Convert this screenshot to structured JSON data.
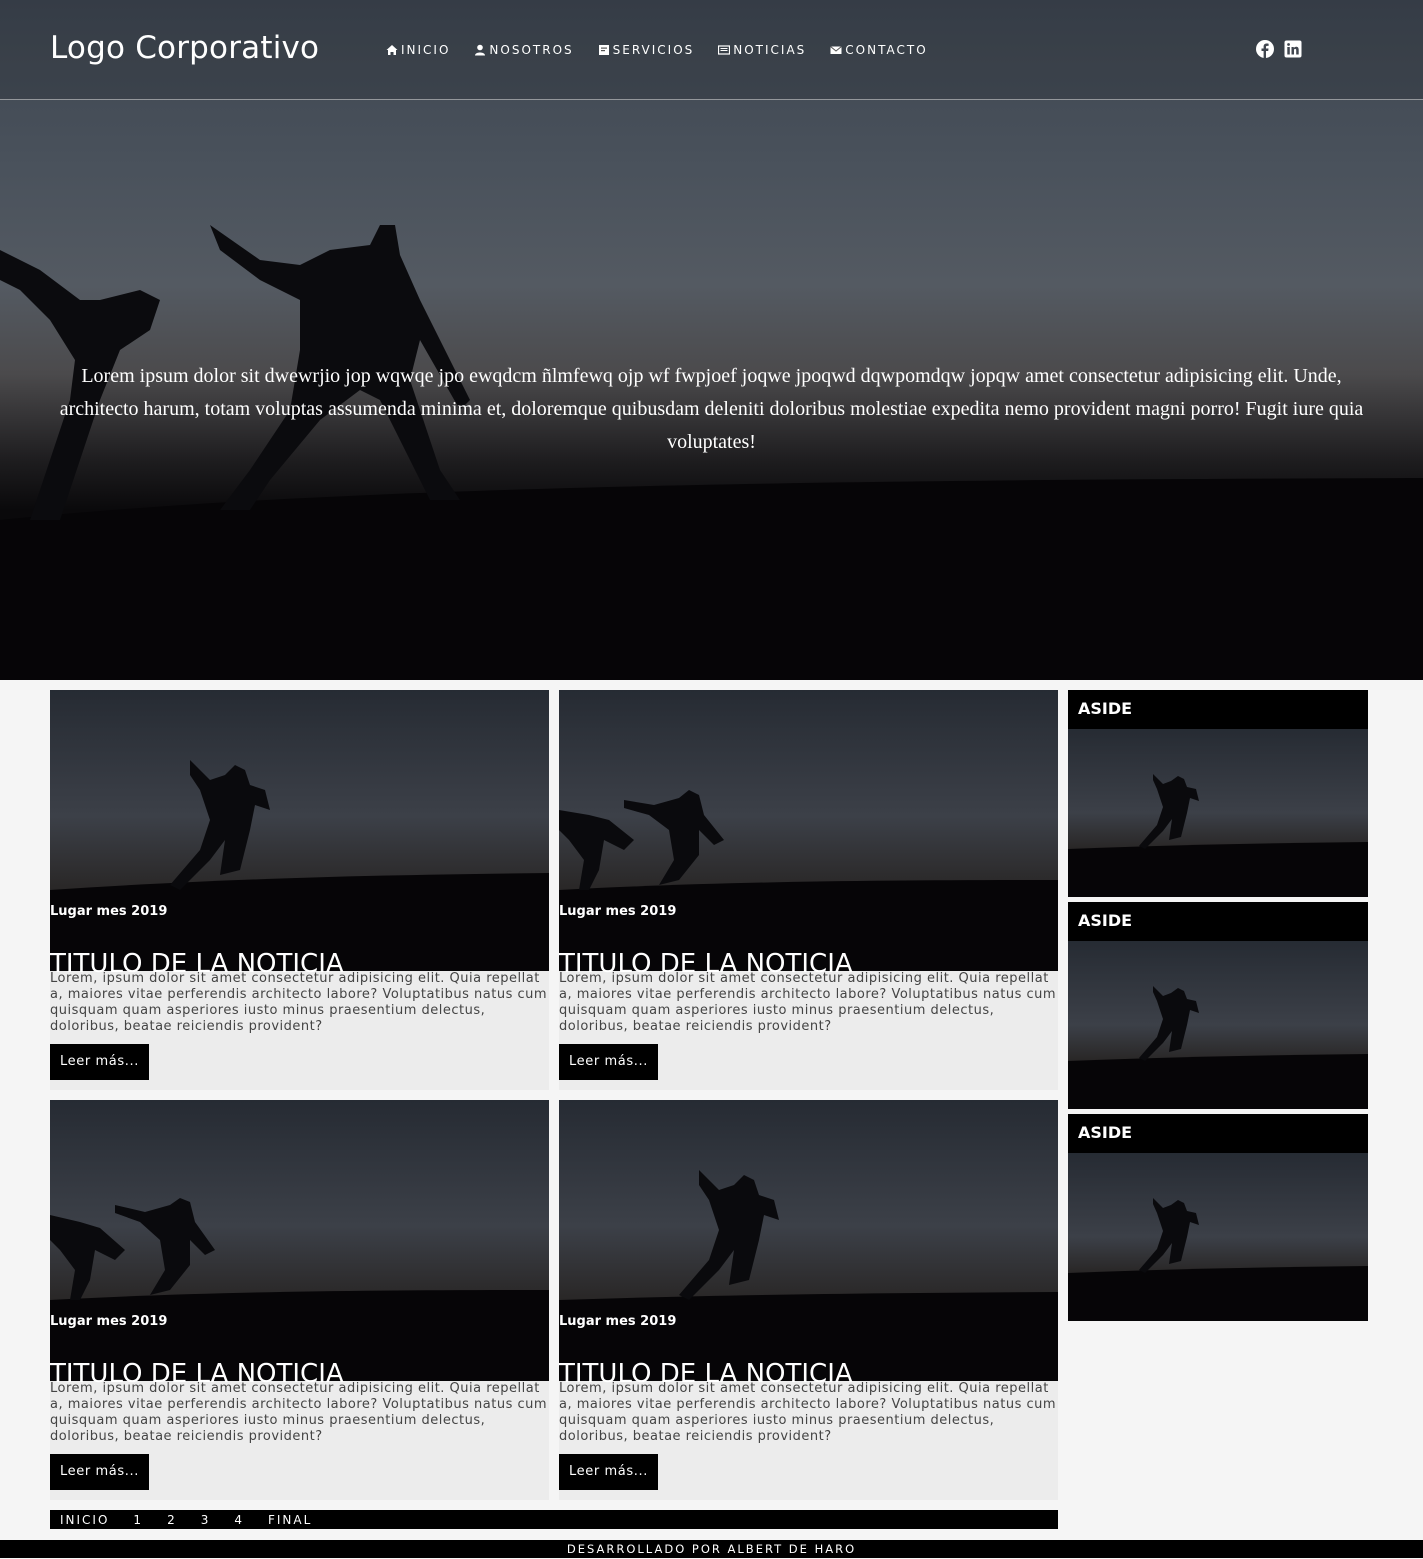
{
  "header": {
    "logo": "Logo Corporativo",
    "nav": [
      {
        "label": "INICIO",
        "icon": "home-icon"
      },
      {
        "label": "NOSOTROS",
        "icon": "user-icon"
      },
      {
        "label": "SERVICIOS",
        "icon": "services-icon"
      },
      {
        "label": "NOTICIAS",
        "icon": "newspaper-icon"
      },
      {
        "label": "CONTACTO",
        "icon": "envelope-icon"
      }
    ],
    "social": [
      "facebook-icon",
      "linkedin-icon"
    ]
  },
  "hero": {
    "text": "Lorem ipsum dolor sit dwewrjio jop wqwqe jpo ewqdcm ñlmfewq ojp wf fwpjoef joqwe jpoqwd dqwpomdqw jopqw amet consectetur adipisicing elit. Unde, architecto harum, totam voluptas assumenda minima et, doloremque quibusdam deleniti doloribus molestiae expedita nemo provident magni porro! Fugit iure quia voluptates!"
  },
  "cards": [
    {
      "meta": "Lugar mes 2019",
      "title": "TITULO DE LA NOTICIA",
      "excerpt": "Lorem, ipsum dolor sit amet consectetur adipisicing elit. Quia repellat a, maiores vitae perferendis architecto labore? Voluptatibus natus cum quisquam quam asperiores iusto minus praesentium delectus, doloribus, beatae reiciendis provident?",
      "button": "Leer más..."
    },
    {
      "meta": "Lugar mes 2019",
      "title": "TITULO DE LA NOTICIA",
      "excerpt": "Lorem, ipsum dolor sit amet consectetur adipisicing elit. Quia repellat a, maiores vitae perferendis architecto labore? Voluptatibus natus cum quisquam quam asperiores iusto minus praesentium delectus, doloribus, beatae reiciendis provident?",
      "button": "Leer más..."
    },
    {
      "meta": "Lugar mes 2019",
      "title": "TITULO DE LA NOTICIA",
      "excerpt": "Lorem, ipsum dolor sit amet consectetur adipisicing elit. Quia repellat a, maiores vitae perferendis architecto labore? Voluptatibus natus cum quisquam quam asperiores iusto minus praesentium delectus, doloribus, beatae reiciendis provident?",
      "button": "Leer más..."
    },
    {
      "meta": "Lugar mes 2019",
      "title": "TITULO DE LA NOTICIA",
      "excerpt": "Lorem, ipsum dolor sit amet consectetur adipisicing elit. Quia repellat a, maiores vitae perferendis architecto labore? Voluptatibus natus cum quisquam quam asperiores iusto minus praesentium delectus, doloribus, beatae reiciendis provident?",
      "button": "Leer más..."
    }
  ],
  "aside": [
    {
      "title": "ASIDE"
    },
    {
      "title": "ASIDE"
    },
    {
      "title": "ASIDE"
    }
  ],
  "pagination": [
    "INICIO",
    "1",
    "2",
    "3",
    "4",
    "FINAL"
  ],
  "footer": {
    "text": "DESARROLLADO POR ALBERT DE HARO"
  }
}
